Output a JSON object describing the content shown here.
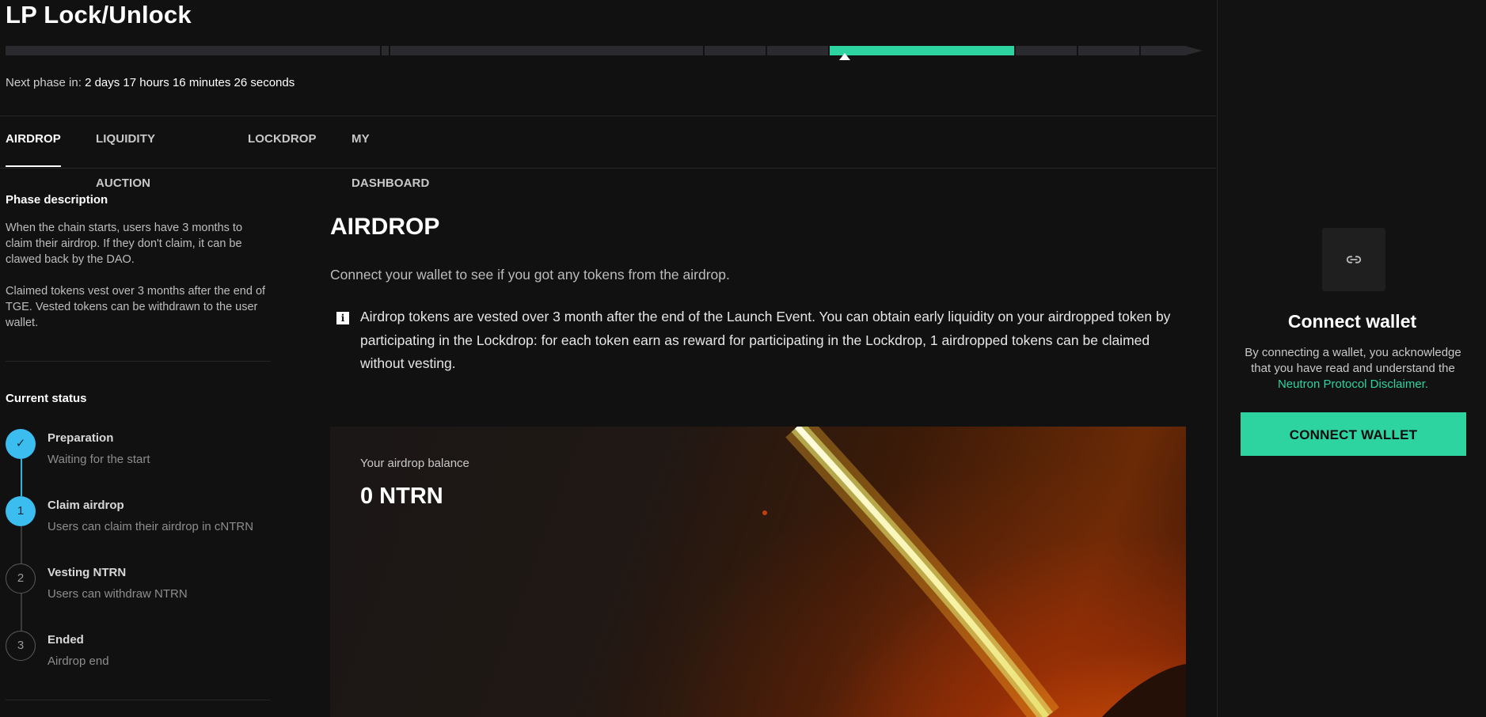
{
  "header": {
    "title": "LP Lock/Unlock",
    "next_phase_label": "Next phase in:",
    "next_phase_value": "2 days 17 hours 16 minutes 26 seconds"
  },
  "phase_progress": {
    "segments": 11,
    "active_segment_index": 6,
    "active_color": "#2dd4a0",
    "inactive_color": "#2b2b2f"
  },
  "tabs": [
    {
      "label": "AIRDROP",
      "active": true
    },
    {
      "label": "LIQUIDITY AUCTION",
      "active": false
    },
    {
      "label": "LOCKDROP",
      "active": false
    },
    {
      "label": "MY DASHBOARD",
      "active": false
    }
  ],
  "sidebar": {
    "phase_description_heading": "Phase description",
    "phase_description_p1": "When the chain starts, users have 3 months to claim their airdrop. If they don't claim, it can be clawed back by the DAO.",
    "phase_description_p2": "Claimed tokens vest over 3 months after the end of TGE. Vested tokens can be withdrawn to the user wallet.",
    "current_status_heading": "Current status",
    "steps": [
      {
        "marker": "✓",
        "title": "Preparation",
        "desc": "Waiting for the start",
        "state": "done"
      },
      {
        "marker": "1",
        "title": "Claim airdrop",
        "desc": "Users can claim their airdrop in cNTRN",
        "state": "current"
      },
      {
        "marker": "2",
        "title": "Vesting NTRN",
        "desc": "Users can withdraw NTRN",
        "state": "upcoming"
      },
      {
        "marker": "3",
        "title": "Ended",
        "desc": "Airdrop end",
        "state": "upcoming"
      }
    ]
  },
  "content": {
    "title": "AIRDROP",
    "subtitle": "Connect your wallet to see if you got any tokens from the airdrop.",
    "info_icon": "i",
    "info_text": "Airdrop tokens are vested over 3 month after the end of the Launch Event. You can obtain early liquidity on your airdropped token by participating in the Lockdrop: for each token earn as reward for participating in the Lockdrop, 1 airdropped tokens can be claimed without vesting.",
    "balance_label": "Your airdrop balance",
    "balance_value": "0 NTRN"
  },
  "wallet_panel": {
    "icon": "link-icon",
    "title": "Connect wallet",
    "text": "By connecting a wallet, you acknowledge that you have read and understand the",
    "link_text": "Neutron Protocol Disclaimer.",
    "button_label": "CONNECT WALLET",
    "accent_color": "#2dd4a0"
  }
}
